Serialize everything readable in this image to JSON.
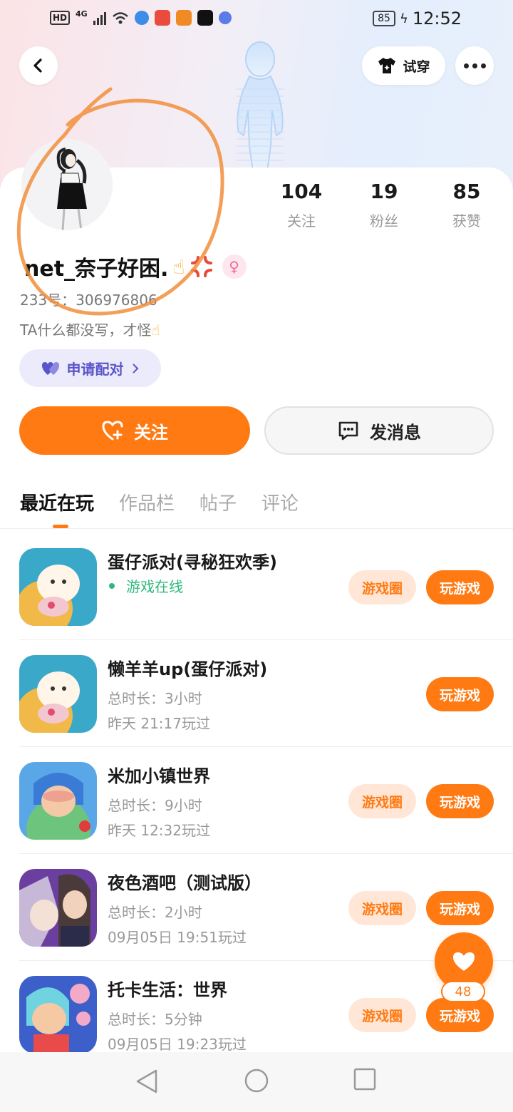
{
  "status_bar": {
    "hd": "HD",
    "network": "4G",
    "battery": "85",
    "time": "12:52"
  },
  "header": {
    "tryon_label": "试穿"
  },
  "profile": {
    "stats": [
      {
        "num": "104",
        "label": "关注"
      },
      {
        "num": "19",
        "label": "粉丝"
      },
      {
        "num": "85",
        "label": "获赞"
      }
    ],
    "username": "net_奈子好困.",
    "uid": "233号：306976806",
    "bio": "TA什么都没写，才怪"
  },
  "pair_button": "申请配对",
  "actions": {
    "follow": "关注",
    "message": "发消息"
  },
  "tabs": [
    "最近在玩",
    "作品栏",
    "帖子",
    "评论"
  ],
  "games": [
    {
      "name": "蛋仔派对(寻秘狂欢季)",
      "online": "游戏在线",
      "duration": "",
      "last": "",
      "circle": "游戏圈",
      "play": "玩游戏"
    },
    {
      "name": "懒羊羊up(蛋仔派对)",
      "online": "",
      "duration": "总时长：3小时",
      "last": "昨天 21:17玩过",
      "circle": "",
      "play": "玩游戏"
    },
    {
      "name": "米加小镇世界",
      "online": "",
      "duration": "总时长：9小时",
      "last": "昨天 12:32玩过",
      "circle": "游戏圈",
      "play": "玩游戏"
    },
    {
      "name": "夜色酒吧（测试版）",
      "online": "",
      "duration": "总时长：2小时",
      "last": "09月05日 19:51玩过",
      "circle": "游戏圈",
      "play": "玩游戏"
    },
    {
      "name": "托卡生活：世界",
      "online": "",
      "duration": "总时长：5分钟",
      "last": "09月05日 19:23玩过",
      "circle": "游戏圈",
      "play": "玩游戏"
    }
  ],
  "like_count": "48",
  "colors": {
    "accent": "#ff7a12",
    "online": "#2fb97a",
    "pair": "#5a55c8"
  }
}
